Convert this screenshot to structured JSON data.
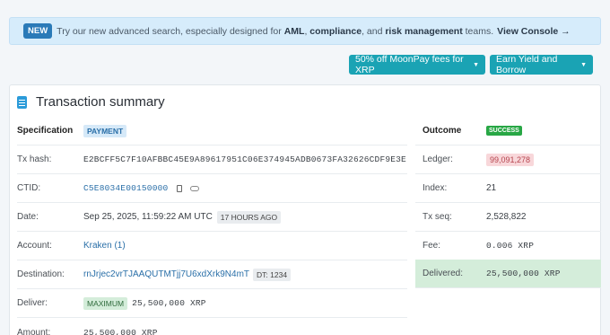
{
  "banner": {
    "new_label": "NEW",
    "text_1": "Try our new advanced search, especially designed for",
    "bold_1": "AML",
    "text_2": ",",
    "bold_2": "compliance",
    "text_3": ", and",
    "bold_3": "risk management",
    "text_4": "teams.",
    "console_label": "View Console →"
  },
  "buttons": {
    "moonpay": "50% off MoonPay fees for XRP",
    "earn": "Earn Yield and Borrow"
  },
  "card": {
    "title": "Transaction summary",
    "left": {
      "specification_label": "Specification",
      "specification_value": "PAYMENT",
      "txhash_label": "Tx hash:",
      "txhash_value": "E2BCFF5C7F10AFBBC45E9A89617951C06E374945ADB0673FA32626CDF9E3E",
      "ctid_label": "CTID:",
      "ctid_value": "C5E8034E00150000",
      "date_label": "Date:",
      "date_value": "Sep 25, 2025, 11:59:22 AM UTC",
      "date_ago": "17 HOURS AGO",
      "account_label": "Account:",
      "account_value": "Kraken (1)",
      "destination_label": "Destination:",
      "destination_value": "rnJrjec2vrTJAAQUTMTjj7U6xdXrk9N4mT",
      "destination_tag": "DT: 1234",
      "deliver_label": "Deliver:",
      "deliver_badge": "MAXIMUM",
      "deliver_value": "25,500,000 XRP",
      "amount_label": "Amount:",
      "amount_value": "25,500,000 XRP"
    },
    "right": {
      "outcome_label": "Outcome",
      "outcome_value": "SUCCESS",
      "ledger_label": "Ledger:",
      "ledger_value": "99,091,278",
      "index_label": "Index:",
      "index_value": "21",
      "txseq_label": "Tx seq:",
      "txseq_value": "2,528,822",
      "fee_label": "Fee:",
      "fee_value": "0.006 XRP",
      "delivered_label": "Delivered:",
      "delivered_value": "25,500,000 XRP"
    }
  }
}
